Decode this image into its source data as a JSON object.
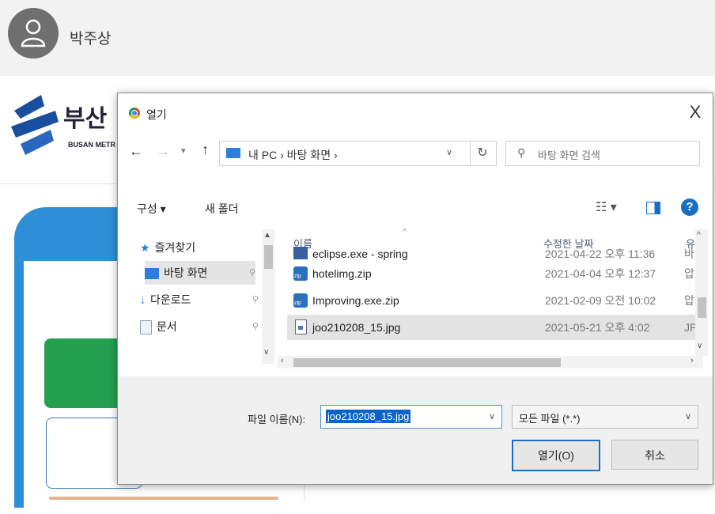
{
  "header": {
    "username": "박주상"
  },
  "bg_logo": {
    "text": "부산",
    "sub": "BUSAN METR"
  },
  "dialog": {
    "title": "열기",
    "close": "X",
    "address": "내 PC  ›  바탕 화면  ›",
    "address_prefix": "›",
    "search_placeholder": "바탕 화면 검색",
    "toolbar": {
      "organize": "구성 ▾",
      "new_folder": "새 폴더",
      "view": "☷ ▾",
      "help": "?"
    },
    "nav_pane": {
      "favorites": "즐겨찾기",
      "items": [
        {
          "label": "바탕 화면"
        },
        {
          "label": "다운로드"
        },
        {
          "label": "문서"
        }
      ]
    },
    "columns": {
      "name": "이름",
      "date": "수정한 날짜",
      "type": "유"
    },
    "files": [
      {
        "name": "eclipse.exe - spring",
        "date": "2021-04-22 오후 11:36",
        "type": "바"
      },
      {
        "name": "hotelimg.zip",
        "date": "2021-04-04 오후 12:37",
        "type": "압"
      },
      {
        "name": "Improving.exe.zip",
        "date": "2021-02-09 오전 10:02",
        "type": "압"
      },
      {
        "name": "joo210208_15.jpg",
        "date": "2021-05-21 오후 4:02",
        "type": "JP"
      }
    ],
    "filename_label": "파일 이름(N):",
    "filename_value": "joo210208_15.jpg",
    "filetype_value": "모든 파일 (*.*)",
    "open_button": "열기(O)",
    "cancel_button": "취소"
  }
}
